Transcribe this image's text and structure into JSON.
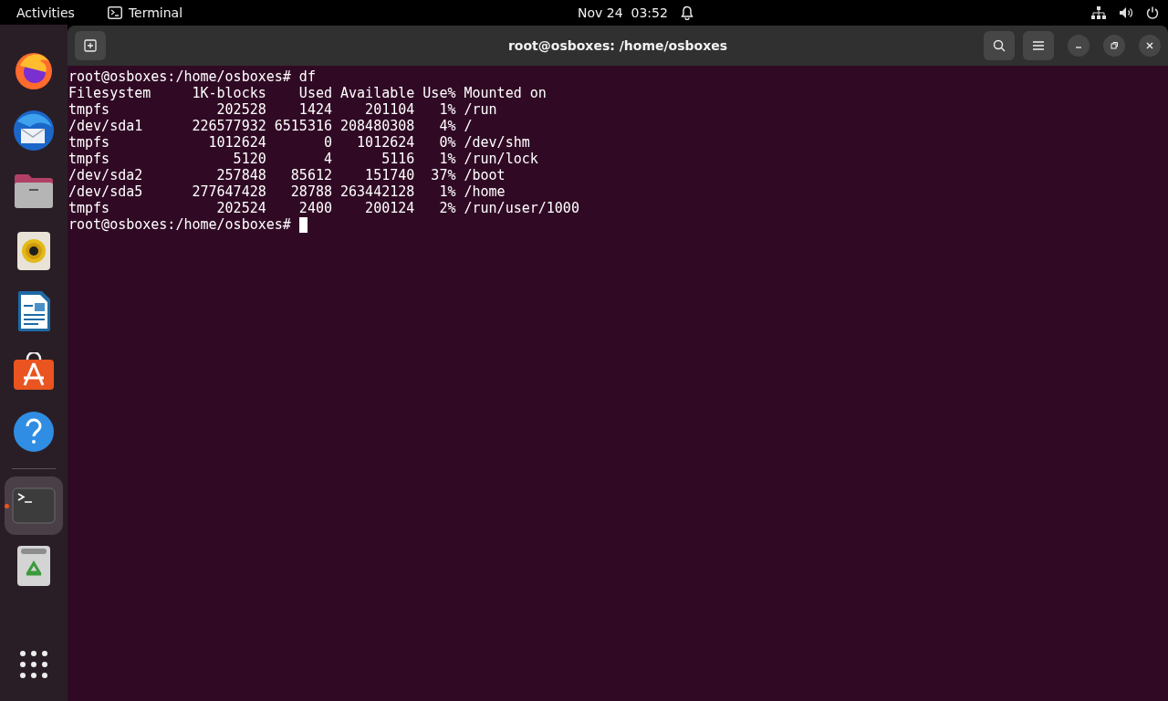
{
  "top_bar": {
    "activities": "Activities",
    "app_name": "Terminal",
    "clock": "Nov 24  03:52"
  },
  "dock": {
    "items": [
      {
        "kind": "firefox",
        "selected": false
      },
      {
        "kind": "mail",
        "selected": false
      },
      {
        "kind": "files",
        "selected": false
      },
      {
        "kind": "speaker",
        "selected": false
      },
      {
        "kind": "writer",
        "selected": false
      },
      {
        "kind": "store",
        "selected": false
      },
      {
        "kind": "help",
        "selected": false
      },
      {
        "kind": "terminal",
        "selected": true
      },
      {
        "kind": "trash",
        "selected": false
      }
    ]
  },
  "window": {
    "title": "root@osboxes: /home/osboxes"
  },
  "terminal": {
    "lines": [
      "root@osboxes:/home/osboxes# df",
      "Filesystem     1K-blocks    Used Available Use% Mounted on",
      "tmpfs             202528    1424    201104   1% /run",
      "/dev/sda1      226577932 6515316 208480308   4% /",
      "tmpfs            1012624       0   1012624   0% /dev/shm",
      "tmpfs               5120       4      5116   1% /run/lock",
      "/dev/sda2         257848   85612    151740  37% /boot",
      "/dev/sda5      277647428   28788 263442128   1% /home",
      "tmpfs             202524    2400    200124   2% /run/user/1000"
    ],
    "prompt": "root@osboxes:/home/osboxes#"
  }
}
